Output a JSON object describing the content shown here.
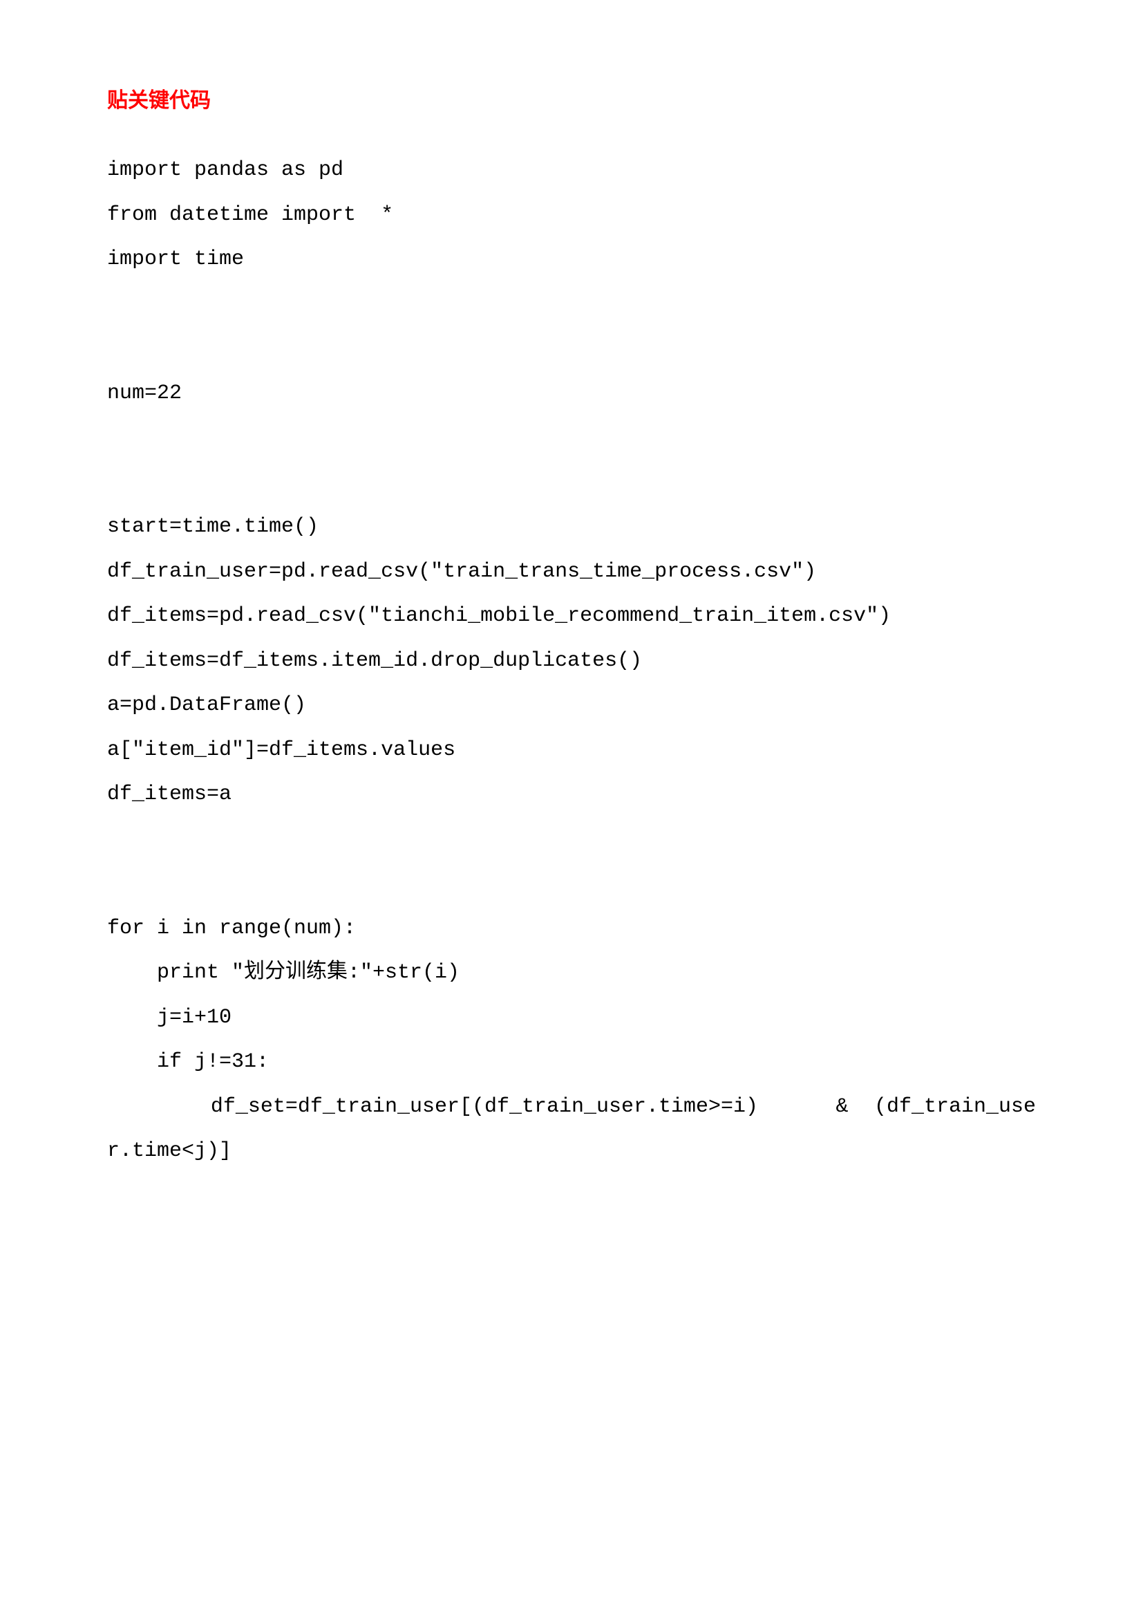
{
  "heading": "贴关键代码",
  "code": "import pandas as pd\nfrom datetime import  *\nimport time\n\n\nnum=22\n\n\nstart=time.time()\ndf_train_user=pd.read_csv(\"train_trans_time_process.csv\")\ndf_items=pd.read_csv(\"tianchi_mobile_recommend_train_item.csv\")\ndf_items=df_items.item_id.drop_duplicates()\na=pd.DataFrame()\na[\"item_id\"]=df_items.values\ndf_items=a\n\n\nfor i in range(num):\n    print \"划分训练集:\"+str(i)\n    j=i+10\n    if j!=31:\n        df_set=df_train_user[(df_train_user.time>=i)      &  (df_train_user.time<j)]"
}
